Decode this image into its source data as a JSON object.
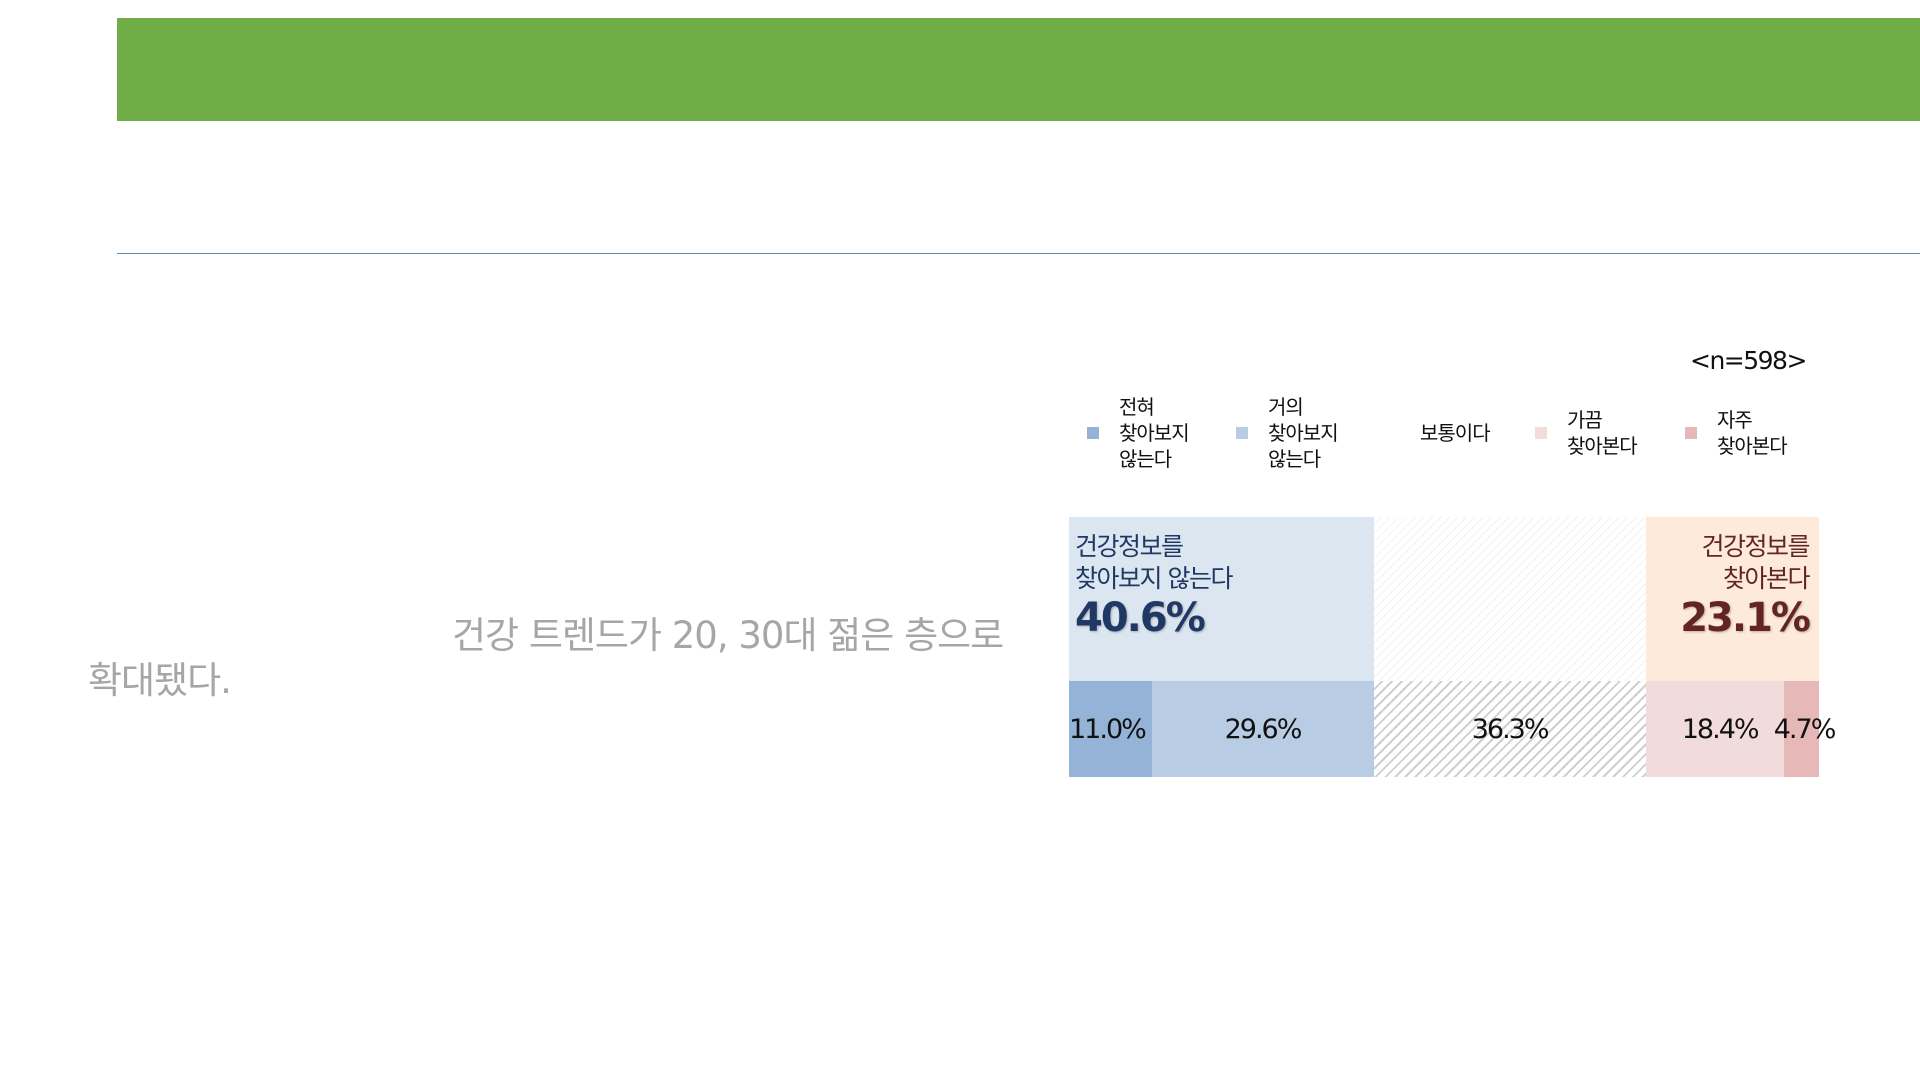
{
  "body_text": {
    "line1": "건강 트렌드가 20, 30대 젊은 층으로",
    "line2": "확대됐다."
  },
  "chart_data": {
    "type": "bar",
    "orientation": "horizontal-stacked-100",
    "sample_note": "<n=598>",
    "series": [
      {
        "name": "전혀\n찾아보지\n않는다",
        "value": 11.0,
        "label": "11.0%",
        "color": "#95b3d7"
      },
      {
        "name": "거의\n찾아보지\n않는다",
        "value": 29.6,
        "label": "29.6%",
        "color": "#b8cce4"
      },
      {
        "name": "보통이다",
        "value": 36.3,
        "label": "36.3%",
        "color": "#d9d9d9",
        "pattern": "hatch"
      },
      {
        "name": "가끔\n찾아본다",
        "value": 18.4,
        "label": "18.4%",
        "color": "#f2dcdb"
      },
      {
        "name": "자주\n찾아본다",
        "value": 4.7,
        "label": "4.7%",
        "color": "#e6b9b8"
      }
    ],
    "groups": [
      {
        "title": "건강정보를\n찾아보지 않는다",
        "value": 40.6,
        "label": "40.6%",
        "bg": "#dce6f1",
        "text_color": "#1f3864",
        "from": 0,
        "to": 1
      },
      {
        "title": "건강정보를\n찾아본다",
        "value": 23.1,
        "label": "23.1%",
        "bg": "#fdeada",
        "text_color": "#632523",
        "from": 3,
        "to": 4
      }
    ]
  }
}
